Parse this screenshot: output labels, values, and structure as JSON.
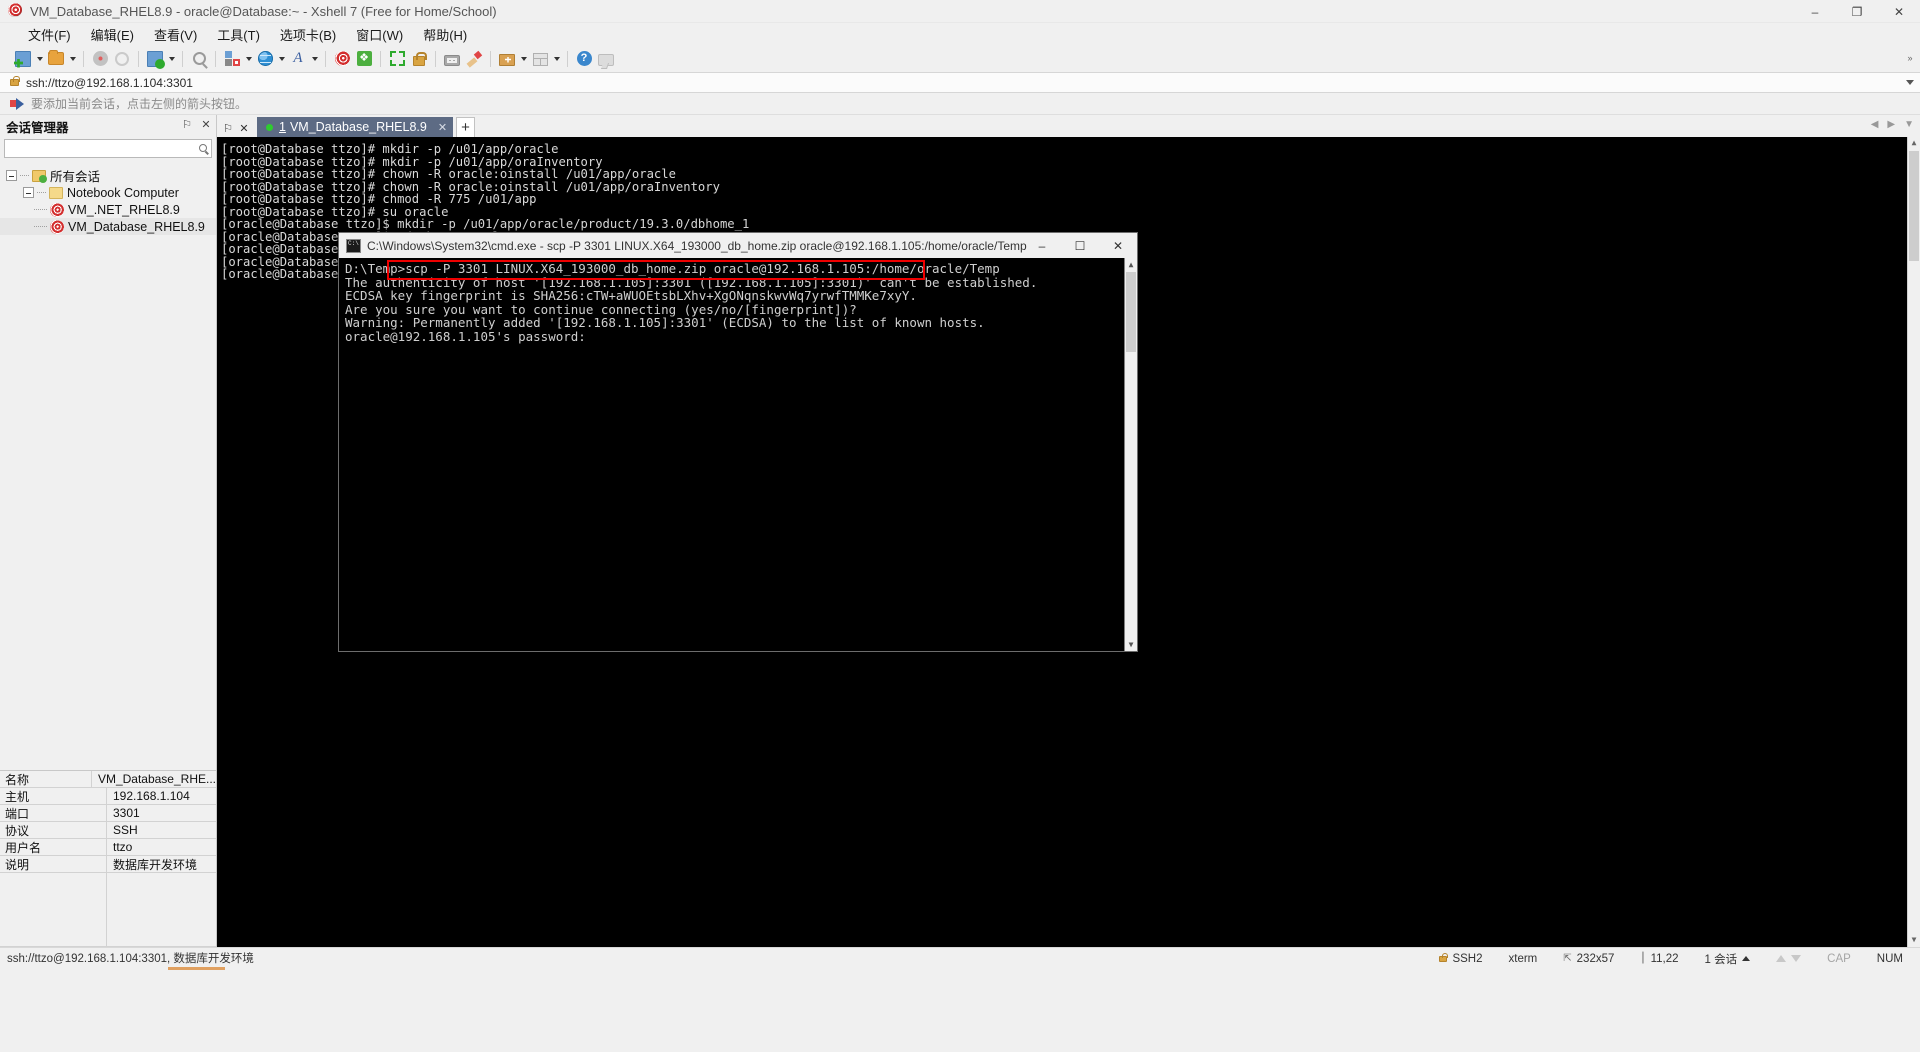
{
  "window": {
    "title": "VM_Database_RHEL8.9 - oracle@Database:~ - Xshell 7 (Free for Home/School)",
    "minimize": "–",
    "maximize": "❐",
    "close": "✕",
    "app_icon": "xshell-icon"
  },
  "menu": {
    "items": [
      {
        "label": "文件(F)",
        "name": "menu-file"
      },
      {
        "label": "编辑(E)",
        "name": "menu-edit"
      },
      {
        "label": "查看(V)",
        "name": "menu-view"
      },
      {
        "label": "工具(T)",
        "name": "menu-tools"
      },
      {
        "label": "选项卡(B)",
        "name": "menu-tabs"
      },
      {
        "label": "窗口(W)",
        "name": "menu-window"
      },
      {
        "label": "帮助(H)",
        "name": "menu-help"
      }
    ]
  },
  "toolbar": {
    "collapse_glyph": "»",
    "buttons": [
      {
        "name": "new-session-icon",
        "shape": "new-tab",
        "caret": true
      },
      {
        "name": "open-folder-icon",
        "shape": "folder",
        "caret": true
      },
      {
        "name": "disconnect-icon",
        "shape": "disconnect",
        "caret": false
      },
      {
        "name": "reconnect-icon",
        "shape": "link",
        "caret": false
      },
      {
        "name": "session-properties-icon",
        "shape": "props",
        "caret": true
      },
      {
        "name": "find-icon",
        "shape": "search",
        "caret": false
      },
      {
        "name": "layout-icon",
        "shape": "layout",
        "caret": true
      },
      {
        "name": "globe-icon",
        "shape": "globe",
        "caret": true
      },
      {
        "name": "font-icon",
        "shape": "fontA",
        "caret": true
      },
      {
        "name": "xshell-icon",
        "shape": "xshell-red",
        "caret": false
      },
      {
        "name": "xftp-icon",
        "shape": "xftp-green",
        "caret": false
      },
      {
        "name": "fullscreen-icon",
        "shape": "fullscreen",
        "caret": false
      },
      {
        "name": "lock-icon",
        "shape": "lock",
        "caret": false
      },
      {
        "name": "keyboard-icon",
        "shape": "keyboard",
        "caret": false
      },
      {
        "name": "highlight-icon",
        "shape": "highlight",
        "caret": false
      },
      {
        "name": "new-folder-icon",
        "shape": "newfolder",
        "caret": true
      },
      {
        "name": "grid-layout-icon",
        "shape": "grid",
        "caret": true
      },
      {
        "name": "help-icon",
        "shape": "help",
        "caret": false
      },
      {
        "name": "chat-icon",
        "shape": "chat",
        "caret": false
      }
    ]
  },
  "address_bar": {
    "value": "ssh://ttzo@192.168.1.104:3301",
    "icon": "lock-icon",
    "dropdown_icon": "chevron-down-icon"
  },
  "notice_bar": {
    "text": "要添加当前会话，点击左侧的箭头按钮。",
    "icon": "arrow-right-icon"
  },
  "sidebar": {
    "title": "会话管理器",
    "pin_glyph": "⚐",
    "close_glyph": "✕",
    "search_placeholder": "",
    "search_value": "",
    "tree": [
      {
        "label": "所有会话",
        "icon": "all-sessions-icon",
        "depth": 0,
        "expander": true,
        "selected": false
      },
      {
        "label": "Notebook Computer",
        "icon": "folder-icon",
        "depth": 1,
        "expander": true,
        "selected": false
      },
      {
        "label": "VM_.NET_RHEL8.9",
        "icon": "session-icon",
        "depth": 2,
        "expander": false,
        "selected": false
      },
      {
        "label": "VM_Database_RHEL8.9",
        "icon": "session-icon",
        "depth": 2,
        "expander": false,
        "selected": true
      }
    ],
    "properties": [
      {
        "key": "名称",
        "value": "VM_Database_RHE..."
      },
      {
        "key": "主机",
        "value": "192.168.1.104"
      },
      {
        "key": "端口",
        "value": "3301"
      },
      {
        "key": "协议",
        "value": "SSH"
      },
      {
        "key": "用户名",
        "value": "ttzo"
      },
      {
        "key": "说明",
        "value": "数据库开发环境"
      }
    ]
  },
  "tabbar": {
    "pin_glyph": "⚐",
    "close_glyph": "✕",
    "tabs": [
      {
        "number": "1",
        "label": "VM_Database_RHEL8.9",
        "status": "connected",
        "close": "✕"
      }
    ],
    "new_tab_glyph": "+",
    "nav_prev": "◀",
    "nav_next": "▶",
    "nav_menu": "▼"
  },
  "terminal": {
    "lines": [
      "[root@Database ttzo]# mkdir -p /u01/app/oracle",
      "[root@Database ttzo]# mkdir -p /u01/app/oraInventory",
      "[root@Database ttzo]# chown -R oracle:oinstall /u01/app/oracle",
      "[root@Database ttzo]# chown -R oracle:oinstall /u01/app/oraInventory",
      "[root@Database ttzo]# chmod -R 775 /u01/app",
      "[root@Database ttzo]# su oracle",
      "[oracle@Database ttzo]$ mkdir -p /u01/app/oracle/product/19.3.0/dbhome_1",
      "[oracle@Database ttzo]$ cd /home/oracle/",
      "[oracle@Database ~]$ dir",
      "[oracle@Database ~]$",
      "[oracle@Database ~]$"
    ]
  },
  "cmd_window": {
    "title": "C:\\Windows\\System32\\cmd.exe - scp  -P 3301 LINUX.X64_193000_db_home.zip oracle@192.168.1.105:/home/oracle/Temp",
    "icon": "cmd-icon",
    "minimize": "–",
    "maximize": "☐",
    "close": "✕",
    "highlighted_command": "scp -P 3301 LINUX.X64_193000_db_home.zip oracle@192.168.1.105:/home/oracle/Temp",
    "lines": [
      "D:\\Temp>scp -P 3301 LINUX.X64_193000_db_home.zip oracle@192.168.1.105:/home/oracle/Temp",
      "The authenticity of host '[192.168.1.105]:3301 ([192.168.1.105]:3301)' can't be established.",
      "ECDSA key fingerprint is SHA256:cTW+aWUOEtsbLXhv+XgONqnskwvWq7yrwfTMMKe7xyY.",
      "Are you sure you want to continue connecting (yes/no/[fingerprint])?",
      "Warning: Permanently added '[192.168.1.105]:3301' (ECDSA) to the list of known hosts.",
      "oracle@192.168.1.105's password:"
    ],
    "highlight_color": "#ee0000"
  },
  "statusbar": {
    "left": "ssh://ttzo@192.168.1.104:3301, 数据库开发环境",
    "protocol": "SSH2",
    "terminal_type": "xterm",
    "dimensions": "232x57",
    "cursor": "11,22",
    "sessions": "1 会话",
    "cap": "CAP",
    "num": "NUM"
  }
}
